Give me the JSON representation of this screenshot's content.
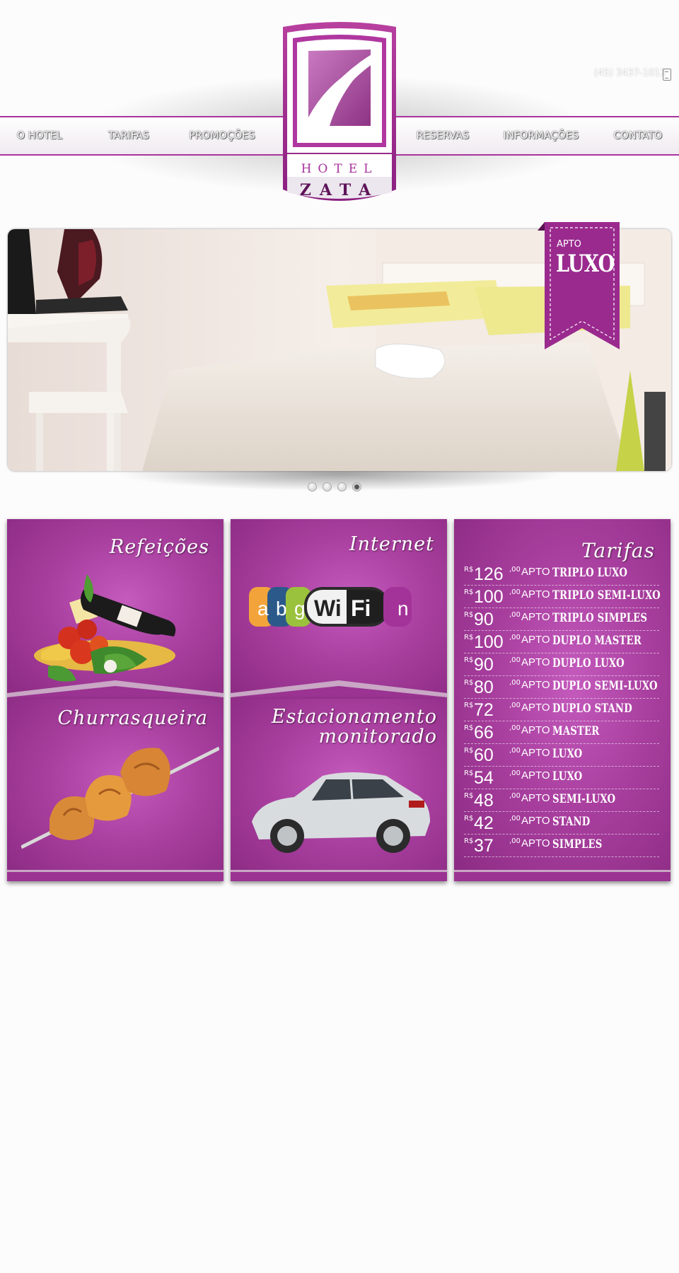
{
  "nav": {
    "items": [
      "O HOTEL",
      "TARIFAS",
      "PROMOÇÕES",
      "RESERVAS",
      "INFORMAÇÕES",
      "CONTATO"
    ]
  },
  "header": {
    "phone": "(45) 3437-1011",
    "phone_icon": "phone-icon"
  },
  "logo": {
    "line1": "HOTEL",
    "line2": "ZATA"
  },
  "slider": {
    "ribbon_small": "APTO",
    "ribbon_big": "LUXO",
    "dots_count": 4,
    "active_dot": 4
  },
  "panels": {
    "meals": "Refeições",
    "internet": "Internet",
    "wifi_letters": [
      "a",
      "b",
      "g",
      "Wi",
      "Fi",
      "n"
    ],
    "barbecue": "Churrasqueira",
    "parking_line1": "Estacionamento",
    "parking_line2": "monitorado"
  },
  "rates": {
    "title": "Tarifas",
    "currency": "R$",
    "cents": ",00",
    "apto": "APTO",
    "rows": [
      {
        "value": "126",
        "room": "TRIPLO LUXO"
      },
      {
        "value": "100",
        "room": "TRIPLO SEMI-LUXO"
      },
      {
        "value": "90",
        "room": "TRIPLO SIMPLES"
      },
      {
        "value": "100",
        "room": "DUPLO MASTER"
      },
      {
        "value": "90",
        "room": "DUPLO LUXO"
      },
      {
        "value": "80",
        "room": "DUPLO SEMI-LUXO"
      },
      {
        "value": "72",
        "room": "DUPLO STAND"
      },
      {
        "value": "66",
        "room": "MASTER"
      },
      {
        "value": "60",
        "room": "LUXO"
      },
      {
        "value": "54",
        "room": "LUXO"
      },
      {
        "value": "48",
        "room": "SEMI-LUXO"
      },
      {
        "value": "42",
        "room": "STAND"
      },
      {
        "value": "37",
        "room": "SIMPLES"
      }
    ]
  },
  "colors": {
    "brand_purple": "#a8349c",
    "panel_light": "#c45bbd",
    "panel_dark": "#8a2a82"
  }
}
